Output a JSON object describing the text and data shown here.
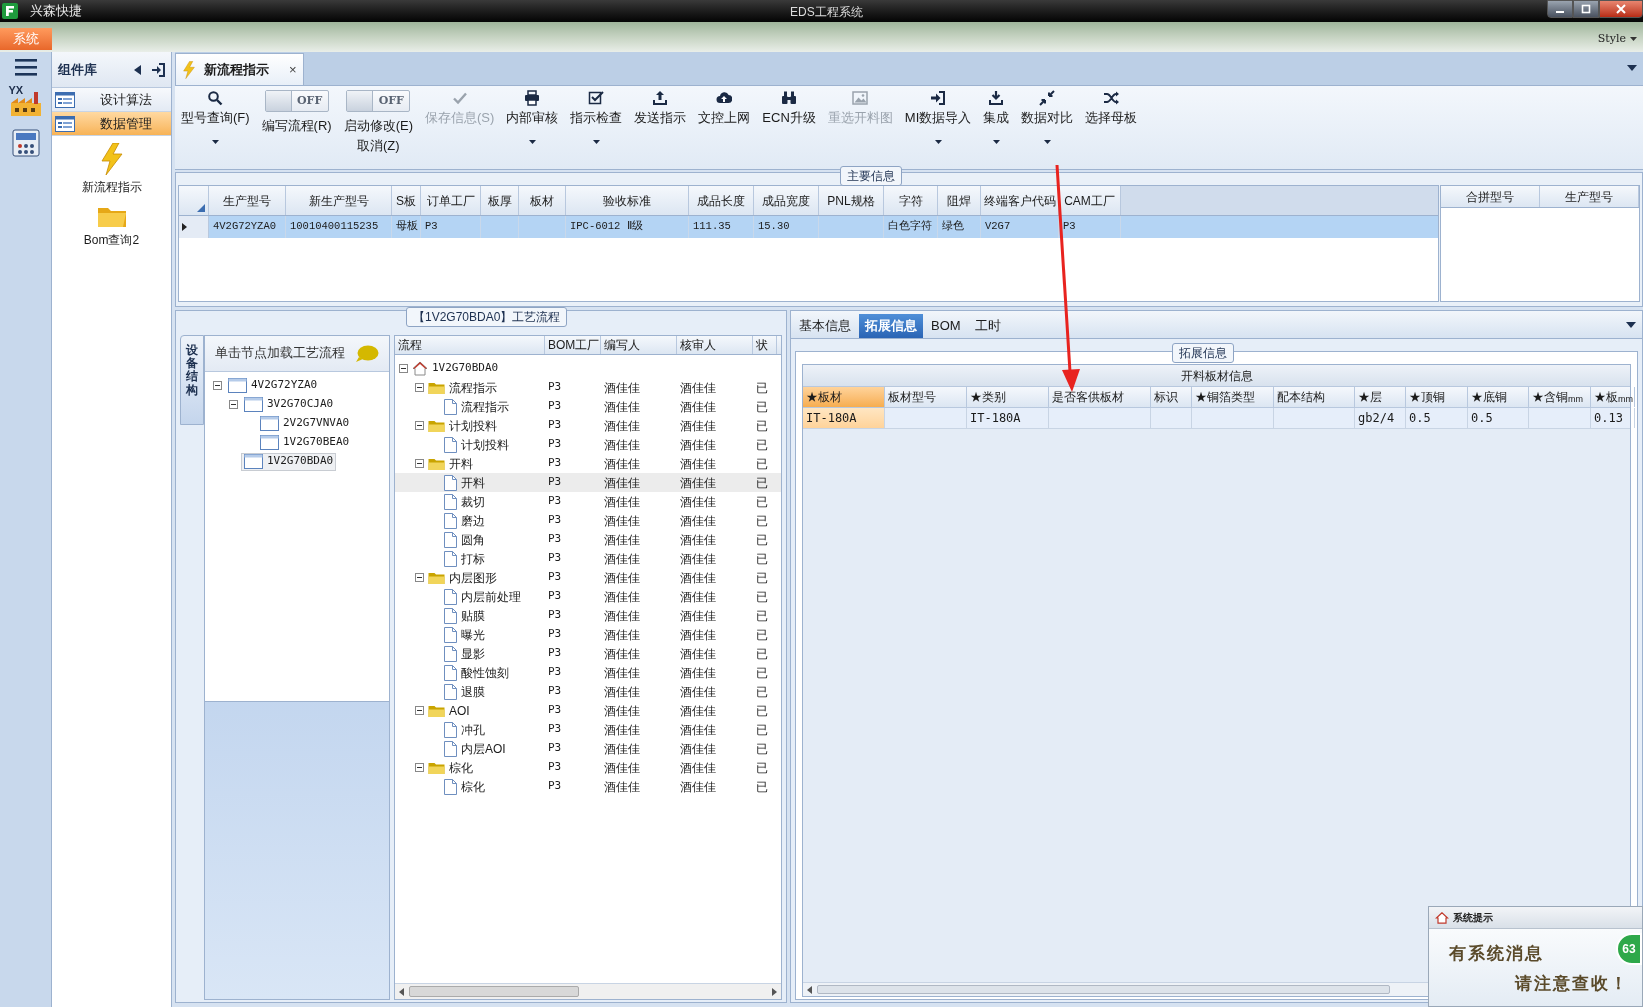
{
  "title_bar": {
    "app_name": "兴森快捷",
    "title": "EDS工程系统"
  },
  "menu": {
    "tab": "系统",
    "style_menu": "Style"
  },
  "rail": {
    "logo_text": "YX"
  },
  "component_panel": {
    "title": "组件库",
    "items": [
      {
        "label": "设计算法",
        "selected": false
      },
      {
        "label": "数据管理",
        "selected": true
      }
    ],
    "launchers": [
      {
        "label": "新流程指示",
        "kind": "bolt"
      },
      {
        "label": "Bom查询2",
        "kind": "folder"
      }
    ]
  },
  "doc_tab": {
    "label": "新流程指示",
    "close": "×"
  },
  "toolbar": [
    {
      "kind": "button",
      "label": "型号查询(F)",
      "disabled": false,
      "dropdown": true
    },
    {
      "kind": "toggle",
      "label": "编写流程(R)",
      "on": false,
      "state_text": "OFF"
    },
    {
      "kind": "toggle",
      "label": "启动修改(E)",
      "second_label": "取消(Z)",
      "on": false,
      "state_text": "OFF"
    },
    {
      "kind": "button",
      "label": "保存信息(S)",
      "disabled": true,
      "dropdown": false
    },
    {
      "kind": "button",
      "label": "内部审核",
      "disabled": false,
      "dropdown": true
    },
    {
      "kind": "button",
      "label": "指示检查",
      "disabled": false,
      "dropdown": true
    },
    {
      "kind": "button",
      "label": "发送指示",
      "disabled": false,
      "dropdown": false
    },
    {
      "kind": "button",
      "label": "文控上网",
      "disabled": false,
      "dropdown": false
    },
    {
      "kind": "button",
      "label": "ECN升级",
      "disabled": false,
      "dropdown": false
    },
    {
      "kind": "button",
      "label": "重选开料图",
      "disabled": true,
      "dropdown": false
    },
    {
      "kind": "button",
      "label": "MI数据导入",
      "disabled": false,
      "dropdown": true
    },
    {
      "kind": "button",
      "label": "集成",
      "disabled": false,
      "dropdown": true
    },
    {
      "kind": "button",
      "label": "数据对比",
      "disabled": false,
      "dropdown": true
    },
    {
      "kind": "button",
      "label": "选择母板",
      "disabled": false,
      "dropdown": false
    }
  ],
  "main_info": {
    "title": "主要信息",
    "columns": [
      "生产型号",
      "新生产型号",
      "S板",
      "订单工厂",
      "板厚",
      "板材",
      "验收标准",
      "成品长度",
      "成品宽度",
      "PNL规格",
      "字符",
      "阻焊",
      "终端客户代码",
      "CAM工厂"
    ],
    "rows": [
      {
        "selected": true,
        "cells": [
          "4V2G72YZA0",
          "10010400115235",
          "母板",
          "P3",
          null,
          null,
          "IPC-6012 Ⅱ级",
          "111.35",
          "15.30",
          null,
          "白色字符",
          "绿色",
          "V2G7",
          "P3"
        ]
      }
    ],
    "side_columns": [
      "合拼型号",
      "生产型号"
    ]
  },
  "process": {
    "title": "【1V2G70BDA0】工艺流程",
    "side_tab": "设备结构",
    "hint": "单击节点加载工艺流程",
    "structure_tree": [
      {
        "label": "4V2G72YZA0",
        "selected": false,
        "expanded": true,
        "children": [
          {
            "label": "3V2G70CJA0",
            "selected": false,
            "expanded": true,
            "children": [
              {
                "label": "2V2G7VNVA0",
                "selected": false
              },
              {
                "label": "1V2G70BEA0",
                "selected": false
              }
            ]
          },
          {
            "label": "1V2G70BDA0",
            "selected": true
          }
        ]
      }
    ],
    "flow_columns": [
      "流程",
      "BOM工厂",
      "编写人",
      "核审人",
      "状"
    ],
    "flow_tree": [
      {
        "kind": "root",
        "label": "1V2G70BDA0",
        "selected": false,
        "expanded": true,
        "children": [
          {
            "kind": "folder",
            "label": "流程指示",
            "bom": "P3",
            "writer": "酒佳佳",
            "reviewer": "酒佳佳",
            "status": "已",
            "selected": false,
            "expanded": true,
            "children": [
              {
                "kind": "step",
                "label": "流程指示",
                "bom": "P3",
                "writer": "酒佳佳",
                "reviewer": "酒佳佳",
                "status": "已",
                "selected": false
              }
            ]
          },
          {
            "kind": "folder",
            "label": "计划投料",
            "bom": "P3",
            "writer": "酒佳佳",
            "reviewer": "酒佳佳",
            "status": "已",
            "selected": false,
            "expanded": true,
            "children": [
              {
                "kind": "step",
                "label": "计划投料",
                "bom": "P3",
                "writer": "酒佳佳",
                "reviewer": "酒佳佳",
                "status": "已",
                "selected": false
              }
            ]
          },
          {
            "kind": "folder",
            "label": "开料",
            "bom": "P3",
            "writer": "酒佳佳",
            "reviewer": "酒佳佳",
            "status": "已",
            "selected": false,
            "expanded": true,
            "children": [
              {
                "kind": "step",
                "label": "开料",
                "bom": "P3",
                "writer": "酒佳佳",
                "reviewer": "酒佳佳",
                "status": "已",
                "selected": true
              },
              {
                "kind": "step",
                "label": "裁切",
                "bom": "P3",
                "writer": "酒佳佳",
                "reviewer": "酒佳佳",
                "status": "已",
                "selected": false
              },
              {
                "kind": "step",
                "label": "磨边",
                "bom": "P3",
                "writer": "酒佳佳",
                "reviewer": "酒佳佳",
                "status": "已",
                "selected": false
              },
              {
                "kind": "step",
                "label": "圆角",
                "bom": "P3",
                "writer": "酒佳佳",
                "reviewer": "酒佳佳",
                "status": "已",
                "selected": false
              },
              {
                "kind": "step",
                "label": "打标",
                "bom": "P3",
                "writer": "酒佳佳",
                "reviewer": "酒佳佳",
                "status": "已",
                "selected": false
              }
            ]
          },
          {
            "kind": "folder",
            "label": "内层图形",
            "bom": "P3",
            "writer": "酒佳佳",
            "reviewer": "酒佳佳",
            "status": "已",
            "selected": false,
            "expanded": true,
            "children": [
              {
                "kind": "step",
                "label": "内层前处理",
                "bom": "P3",
                "writer": "酒佳佳",
                "reviewer": "酒佳佳",
                "status": "已",
                "selected": false
              },
              {
                "kind": "step",
                "label": "贴膜",
                "bom": "P3",
                "writer": "酒佳佳",
                "reviewer": "酒佳佳",
                "status": "已",
                "selected": false
              },
              {
                "kind": "step",
                "label": "曝光",
                "bom": "P3",
                "writer": "酒佳佳",
                "reviewer": "酒佳佳",
                "status": "已",
                "selected": false
              },
              {
                "kind": "step",
                "label": "显影",
                "bom": "P3",
                "writer": "酒佳佳",
                "reviewer": "酒佳佳",
                "status": "已",
                "selected": false
              },
              {
                "kind": "step",
                "label": "酸性蚀刻",
                "bom": "P3",
                "writer": "酒佳佳",
                "reviewer": "酒佳佳",
                "status": "已",
                "selected": false
              },
              {
                "kind": "step",
                "label": "退膜",
                "bom": "P3",
                "writer": "酒佳佳",
                "reviewer": "酒佳佳",
                "status": "已",
                "selected": false
              }
            ]
          },
          {
            "kind": "folder",
            "label": "AOI",
            "bom": "P3",
            "writer": "酒佳佳",
            "reviewer": "酒佳佳",
            "status": "已",
            "selected": false,
            "expanded": true,
            "children": [
              {
                "kind": "step",
                "label": "冲孔",
                "bom": "P3",
                "writer": "酒佳佳",
                "reviewer": "酒佳佳",
                "status": "已",
                "selected": false
              },
              {
                "kind": "step",
                "label": "内层AOI",
                "bom": "P3",
                "writer": "酒佳佳",
                "reviewer": "酒佳佳",
                "status": "已",
                "selected": false
              }
            ]
          },
          {
            "kind": "folder",
            "label": "棕化",
            "bom": "P3",
            "writer": "酒佳佳",
            "reviewer": "酒佳佳",
            "status": "已",
            "selected": false,
            "expanded": true,
            "children": [
              {
                "kind": "step",
                "label": "棕化",
                "bom": "P3",
                "writer": "酒佳佳",
                "reviewer": "酒佳佳",
                "status": "已",
                "selected": false
              }
            ]
          }
        ]
      }
    ]
  },
  "detail": {
    "tabs": [
      {
        "label": "基本信息",
        "selected": false
      },
      {
        "label": "拓展信息",
        "selected": true
      },
      {
        "label": "BOM",
        "selected": false
      },
      {
        "label": "工时",
        "selected": false
      }
    ],
    "group_title": "拓展信息",
    "table_title": "开料板材信息",
    "columns": [
      {
        "label": "★板材",
        "focused": true
      },
      {
        "label": "板材型号",
        "focused": false
      },
      {
        "label": "★类别",
        "focused": false
      },
      {
        "label": "是否客供板材",
        "focused": false
      },
      {
        "label": "标识",
        "focused": false
      },
      {
        "label": "★铜箔类型",
        "focused": false
      },
      {
        "label": "配本结构",
        "focused": false
      },
      {
        "label": "★层",
        "focused": false
      },
      {
        "label": "★顶铜",
        "focused": false
      },
      {
        "label": "★底铜",
        "focused": false
      },
      {
        "label": "★含铜$_{mm}$",
        "focused": false
      },
      {
        "label": "★板$_{mm}$",
        "focused": false
      }
    ],
    "rows": [
      {
        "cells": [
          "IT-180A",
          null,
          "IT-180A",
          null,
          null,
          null,
          null,
          "gb2/4",
          "0.5",
          "0.5",
          null,
          "0.13"
        ]
      }
    ]
  },
  "notification": {
    "title": "系统提示",
    "message": "有系统消息",
    "note": "请注意查收！",
    "badge": "63"
  }
}
